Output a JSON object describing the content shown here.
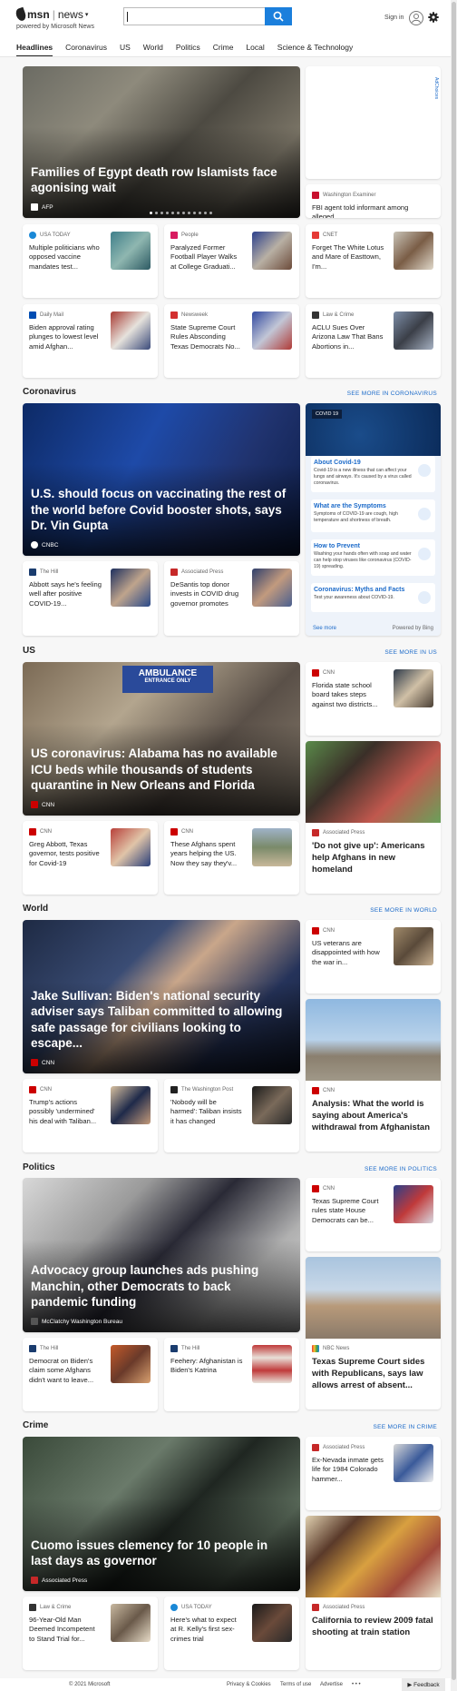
{
  "header": {
    "brand_msn": "msn",
    "brand_news": "news",
    "powered_by": "powered by Microsoft News",
    "search_placeholder": "",
    "signin_label": "Sign in"
  },
  "nav": {
    "tabs": [
      "Headlines",
      "Coronavirus",
      "US",
      "World",
      "Politics",
      "Crime",
      "Local",
      "Science & Technology"
    ]
  },
  "top": {
    "hero": {
      "title": "Families of Egypt death row Islamists face agonising wait",
      "source": "AFP"
    },
    "ad_label": "AdChoices",
    "side": {
      "source": "Washington Examiner",
      "title": "FBI agent told informant among alleged..."
    },
    "cards": [
      {
        "source": "USA TODAY",
        "title": "Multiple politicians who opposed vaccine mandates test..."
      },
      {
        "source": "People",
        "title": "Paralyzed Former Football Player Walks at College Graduati..."
      },
      {
        "source": "CNET",
        "title": "Forget The White Lotus and Mare of Easttown, I'm..."
      },
      {
        "source": "Daily Mail",
        "title": "Biden approval rating plunges to lowest level amid Afghan..."
      },
      {
        "source": "Newsweek",
        "title": "State Supreme Court Rules Absconding Texas Democrats No..."
      },
      {
        "source": "Law & Crime",
        "title": "ACLU Sues Over Arizona Law That Bans Abortions in..."
      }
    ]
  },
  "coronavirus": {
    "heading": "Coronavirus",
    "see_more": "SEE MORE IN CORONAVIRUS",
    "hero": {
      "title": "U.S. should focus on vaccinating the rest of the world before Covid booster shots, says Dr. Vin Gupta",
      "source": "CNBC"
    },
    "cards": [
      {
        "source": "The Hill",
        "title": "Abbott says he's feeling well after positive COVID-19..."
      },
      {
        "source": "Associated Press",
        "title": "DeSantis top donor invests in COVID drug governor promotes"
      }
    ],
    "panel": {
      "badge": "COVID 19",
      "items": [
        {
          "title": "About Covid-19",
          "desc": "Covid-19 is a new illness that can affect your lungs and airways. It's caused by a virus called coronavirus."
        },
        {
          "title": "What are the Symptoms",
          "desc": "Symptoms of COVID-19 are cough, high temperature and shortness of breath."
        },
        {
          "title": "How to Prevent",
          "desc": "Washing your hands often with soap and water can help stop viruses like coronavirus (COVID-19) spreading."
        },
        {
          "title": "Coronavirus: Myths and Facts",
          "desc": "Test your awareness about COVID-19."
        }
      ],
      "see_more": "See more",
      "powered": "Powered by Bing"
    }
  },
  "us": {
    "heading": "US",
    "see_more": "SEE MORE IN US",
    "hero": {
      "title": "US coronavirus: Alabama has no available ICU beds while thousands of students quarantine in New Orleans and Florida",
      "source": "CNN"
    },
    "ambulance_text": "AMBULANCE",
    "ambulance_sub": "ENTRANCE ONLY",
    "side": {
      "source": "CNN",
      "title": "Florida state school board takes steps against two districts..."
    },
    "tall": {
      "source": "Associated Press",
      "title": "'Do not give up': Americans help Afghans in new homeland"
    },
    "cards": [
      {
        "source": "CNN",
        "title": "Greg Abbott, Texas governor, tests positive for Covid-19"
      },
      {
        "source": "CNN",
        "title": "These Afghans spent years helping the US. Now they say they'v..."
      }
    ]
  },
  "world": {
    "heading": "World",
    "see_more": "SEE MORE IN WORLD",
    "hero": {
      "title": "Jake Sullivan: Biden's national security adviser says Taliban committed to allowing safe passage for civilians looking to escape...",
      "source": "CNN"
    },
    "side": {
      "source": "CNN",
      "title": "US veterans are disappointed with how the war in..."
    },
    "tall": {
      "source": "CNN",
      "title": "Analysis: What the world is saying about America's withdrawal from Afghanistan"
    },
    "cards": [
      {
        "source": "CNN",
        "title": "Trump's actions possibly 'undermined' his deal with Taliban..."
      },
      {
        "source": "The Washington Post",
        "title": "'Nobody will be harmed': Taliban insists it has changed"
      }
    ]
  },
  "politics": {
    "heading": "Politics",
    "see_more": "SEE MORE IN POLITICS",
    "hero": {
      "title": "Advocacy group launches ads pushing Manchin, other Democrats to back pandemic funding",
      "source": "McClatchy Washington Bureau"
    },
    "side": {
      "source": "CNN",
      "title": "Texas Supreme Court rules state House Democrats can be..."
    },
    "tall": {
      "source": "NBC News",
      "title": "Texas Supreme Court sides with Republicans, says law allows arrest of absent..."
    },
    "cards": [
      {
        "source": "The Hill",
        "title": "Democrat on Biden's claim some Afghans didn't want to leave..."
      },
      {
        "source": "The Hill",
        "title": "Feehery: Afghanistan is Biden's Katrina"
      }
    ]
  },
  "crime": {
    "heading": "Crime",
    "see_more": "SEE MORE IN CRIME",
    "hero": {
      "title": "Cuomo issues clemency for 10 people in last days as governor",
      "source": "Associated Press"
    },
    "side": {
      "source": "Associated Press",
      "title": "Ex-Nevada inmate gets life for 1984 Colorado hammer..."
    },
    "tall": {
      "source": "Associated Press",
      "title": "California to review 2009 fatal shooting at train station"
    },
    "cards": [
      {
        "source": "Law & Crime",
        "title": "96-Year-Old Man Deemed Incompetent to Stand Trial for..."
      },
      {
        "source": "USA TODAY",
        "title": "Here's what to expect at R. Kelly's first sex-crimes trial"
      }
    ]
  },
  "footer": {
    "copyright": "© 2021 Microsoft",
    "privacy": "Privacy & Cookies",
    "terms": "Terms of use",
    "advertise": "Advertise",
    "more": "• • •",
    "feedback": "Feedback"
  },
  "colors": {
    "accent": "#1b6ac9",
    "search_button": "#1b7fdc",
    "cnn_red": "#cc0000"
  }
}
